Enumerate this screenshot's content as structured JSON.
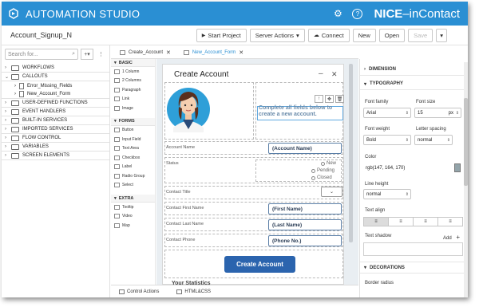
{
  "header": {
    "app_title": "AUTOMATION STUDIO",
    "brand_bold": "NICE",
    "brand_light": "inContact",
    "gear_glyph": "⚙",
    "help_glyph": "?",
    "minimize_glyph": "–",
    "accent_color": "#2a8fd3"
  },
  "toolbar": {
    "project_name": "Account_Signup_N",
    "start_project": "Start Project",
    "server_actions": "Server Actions",
    "connect": "Connect",
    "new": "New",
    "open": "Open",
    "save": "Save",
    "caret": "▾"
  },
  "left_panel": {
    "search_placeholder": "Search for...",
    "search_glyph": "⌕",
    "add_glyph": "+▾",
    "more_glyph": "⋮",
    "items": [
      {
        "label": "WORKFLOWS",
        "chev": "›"
      },
      {
        "label": "CALLOUTS",
        "chev": "⌄"
      },
      {
        "label": "USER-DEFINED FUNCTIONS",
        "chev": "›"
      },
      {
        "label": "EVENT HANDLERS",
        "chev": "›"
      },
      {
        "label": "BUILT-IN SERVICES",
        "chev": "›"
      },
      {
        "label": "IMPORTED SERVICES",
        "chev": "›"
      },
      {
        "label": "FLOW CONTROL",
        "chev": "›"
      },
      {
        "label": "VARIABLES",
        "chev": "›"
      },
      {
        "label": "SCREEN ELEMENTS",
        "chev": "›"
      }
    ],
    "callout_children": [
      {
        "label": "Error_Missing_Fields",
        "chev": "›"
      },
      {
        "label": "New_Account_Form",
        "chev": "›"
      }
    ]
  },
  "tabs": [
    {
      "label": "Create_Account",
      "close": "✕"
    },
    {
      "label": "New_Account_Form",
      "close": "✕"
    }
  ],
  "palette": {
    "basic_header": "BASIC",
    "basic": [
      "1 Column",
      "2 Columns",
      "Paragraph",
      "Link",
      "Image"
    ],
    "forms_header": "FORMS",
    "forms": [
      "Button",
      "Input Field",
      "Text Area",
      "Checkbox",
      "Label",
      "Radio Group",
      "Select"
    ],
    "extra_header": "EXTRA",
    "extra": [
      "Tooltip",
      "Video",
      "Map"
    ],
    "section_glyph": "▾"
  },
  "form": {
    "title": "Create Account",
    "minimize_glyph": "–",
    "close_glyph": "✕",
    "tools": [
      "↑",
      "✥",
      "🗑"
    ],
    "selected_text": "Complete all fields below to create a new account.",
    "fields": [
      {
        "label": "Account Name",
        "value": "(Account Name)"
      },
      {
        "label": "Contact First Name",
        "value": "(First Name)"
      },
      {
        "label": "Contact Last Name",
        "value": "(Last Name)"
      },
      {
        "label": "Contact Phone",
        "value": "(Phone No.)"
      }
    ],
    "status_label": "Status",
    "status_options": [
      "New",
      "Pending",
      "Closed"
    ],
    "title_label": "Contact Title",
    "select_glyph": "⌄",
    "submit_label": "Create Account",
    "stats_title": "Your Statistics",
    "button_color": "#2b64ae"
  },
  "bottom_tabs": [
    {
      "label": "Control Actions"
    },
    {
      "label": "HTML&CSS"
    }
  ],
  "right_panel": {
    "dimension_header": "DIMENSION",
    "typography_header": "TYPOGRAPHY",
    "font_family_label": "Font family",
    "font_family_value": "Arial",
    "font_size_label": "Font size",
    "font_size_value": "15",
    "font_size_unit": "px",
    "font_weight_label": "Font weight",
    "font_weight_value": "Bold",
    "letter_spacing_label": "Letter spacing",
    "letter_spacing_value": "normal",
    "color_label": "Color",
    "color_value": "rgb(147, 164, 170)",
    "line_height_label": "Line height",
    "line_height_value": "normal",
    "text_align_label": "Text align",
    "text_shadow_label": "Text shadow",
    "add_label": "Add",
    "add_glyph": "+",
    "decorations_header": "DECORATIONS",
    "border_radius_label": "Border radius",
    "collapsed_glyph": "›",
    "expanded_glyph": "▾",
    "swatch_color": "#93a4aa",
    "align_glyphs": [
      "≡",
      "≡",
      "≡",
      "≡"
    ],
    "spin_glyph": "⇕"
  }
}
